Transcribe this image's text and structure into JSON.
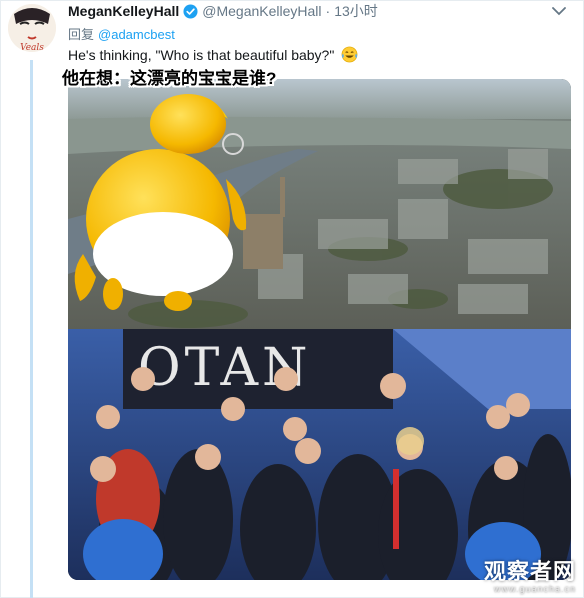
{
  "tweet": {
    "display_name": "MeganKelleyHall",
    "handle": "@MeganKelleyHall",
    "separator": "·",
    "timestamp": "13小时",
    "reply_prefix": "回复",
    "reply_mention": "@adamcbest",
    "text": "He's thinking, \"Who is that beautiful baby?\"",
    "emoji": "face-with-tears-of-joy",
    "verified": true
  },
  "media": {
    "caption": "他在想：这漂亮的宝宝是谁?",
    "sign_text": "OTAN"
  },
  "watermark": {
    "main": "观察者网",
    "sub": "www.guancha.cn"
  },
  "colors": {
    "link": "#1da1f2",
    "muted": "#657786",
    "thread": "#c4e0f5"
  }
}
